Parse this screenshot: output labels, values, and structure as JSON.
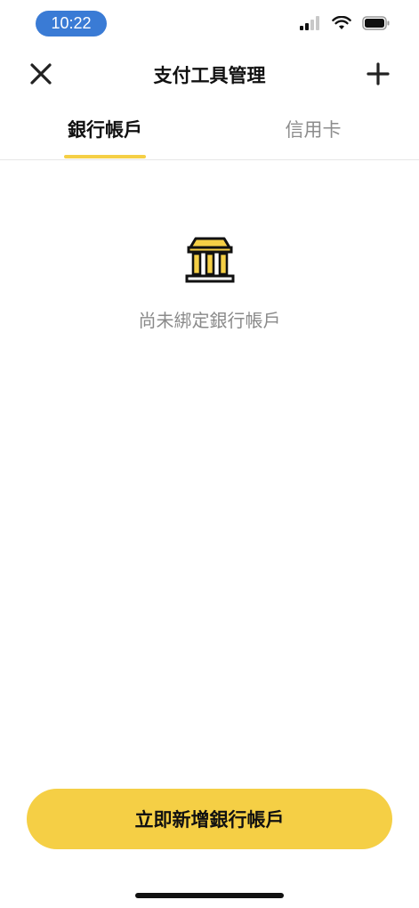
{
  "status_bar": {
    "time": "10:22",
    "icons": [
      "signal-icon",
      "wifi-icon",
      "battery-icon"
    ]
  },
  "header": {
    "title": "支付工具管理",
    "left_icon": "close-icon",
    "right_icon": "plus-icon"
  },
  "tabs": [
    {
      "label": "銀行帳戶",
      "active": true
    },
    {
      "label": "信用卡",
      "active": false
    }
  ],
  "empty_state": {
    "icon": "bank-icon",
    "message": "尚未綁定銀行帳戶"
  },
  "bottom_button": {
    "label": "立即新增銀行帳戶"
  },
  "colors": {
    "accent": "#f5cf45",
    "time_pill": "#3a7bd5",
    "text_primary": "#111111",
    "text_secondary": "#8a8a8a"
  }
}
